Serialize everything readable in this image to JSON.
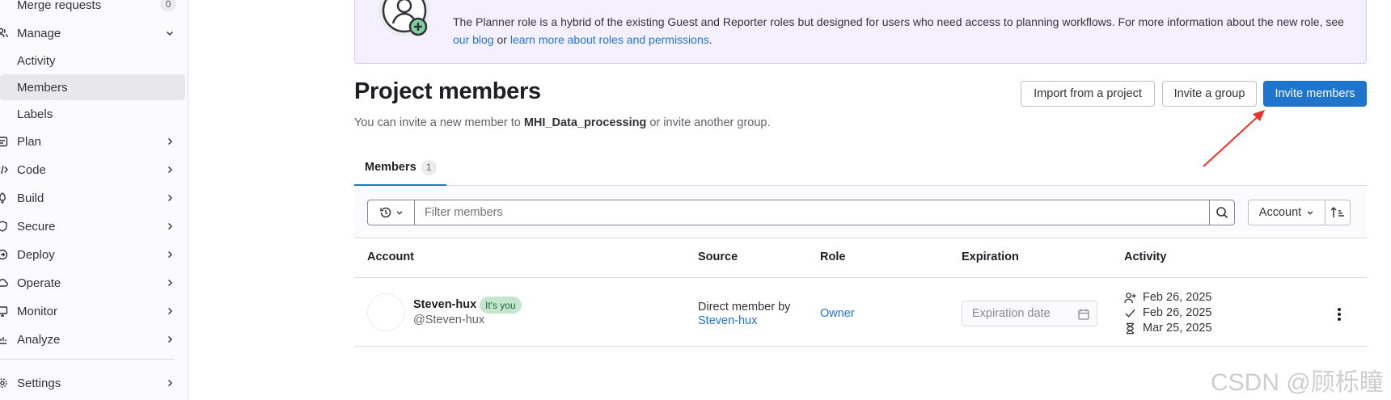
{
  "sidebar": {
    "items": [
      {
        "label": "Merge requests",
        "badge": "0",
        "icon": "merge-request-icon"
      },
      {
        "label": "Manage",
        "icon": "users-icon",
        "expanded": true
      },
      {
        "label": "Activity"
      },
      {
        "label": "Members",
        "active": true
      },
      {
        "label": "Labels"
      },
      {
        "label": "Plan",
        "icon": "planning-icon"
      },
      {
        "label": "Code",
        "icon": "code-icon"
      },
      {
        "label": "Build",
        "icon": "rocket-icon"
      },
      {
        "label": "Secure",
        "icon": "shield-icon"
      },
      {
        "label": "Deploy",
        "icon": "deployments-icon"
      },
      {
        "label": "Operate",
        "icon": "cloud-gear-icon"
      },
      {
        "label": "Monitor",
        "icon": "monitor-icon"
      },
      {
        "label": "Analyze",
        "icon": "chart-icon"
      },
      {
        "label": "Settings",
        "icon": "settings-icon"
      }
    ]
  },
  "alert": {
    "text_before": "The Planner role is a hybrid of the existing Guest and Reporter roles but designed for users who need access to planning workflows. For more information about the new role, see ",
    "link1": "our blog",
    "text_middle": " or ",
    "link2": "learn more about roles and permissions",
    "text_after": "."
  },
  "header": {
    "title": "Project members",
    "subtitle_before": "You can invite a new member to ",
    "project_name": "MHI_Data_processing",
    "subtitle_after": " or invite another group.",
    "buttons": {
      "import": "Import from a project",
      "invite_group": "Invite a group",
      "invite_members": "Invite members"
    }
  },
  "tabs": [
    {
      "label": "Members",
      "count": "1",
      "active": true
    }
  ],
  "filter": {
    "placeholder": "Filter members",
    "sort_label": "Account"
  },
  "table": {
    "columns": [
      "Account",
      "Source",
      "Role",
      "Expiration",
      "Activity"
    ],
    "rows": [
      {
        "name": "Steven-hux",
        "badge": "It's you",
        "handle": "@Steven-hux",
        "source_text": "Direct member by",
        "source_link": "Steven-hux",
        "role": "Owner",
        "expiration_placeholder": "Expiration date",
        "activity": {
          "joined": "Feb 26, 2025",
          "last_activity": "Feb 26, 2025",
          "expires": "Mar 25, 2025"
        }
      }
    ]
  },
  "watermark": "CSDN @顾栎瞳",
  "colors": {
    "primary": "#1f75cb",
    "alert_bg": "#f4f0ff",
    "badge_green_bg": "#c3e6cd",
    "annotation_arrow": "#e8322a"
  }
}
